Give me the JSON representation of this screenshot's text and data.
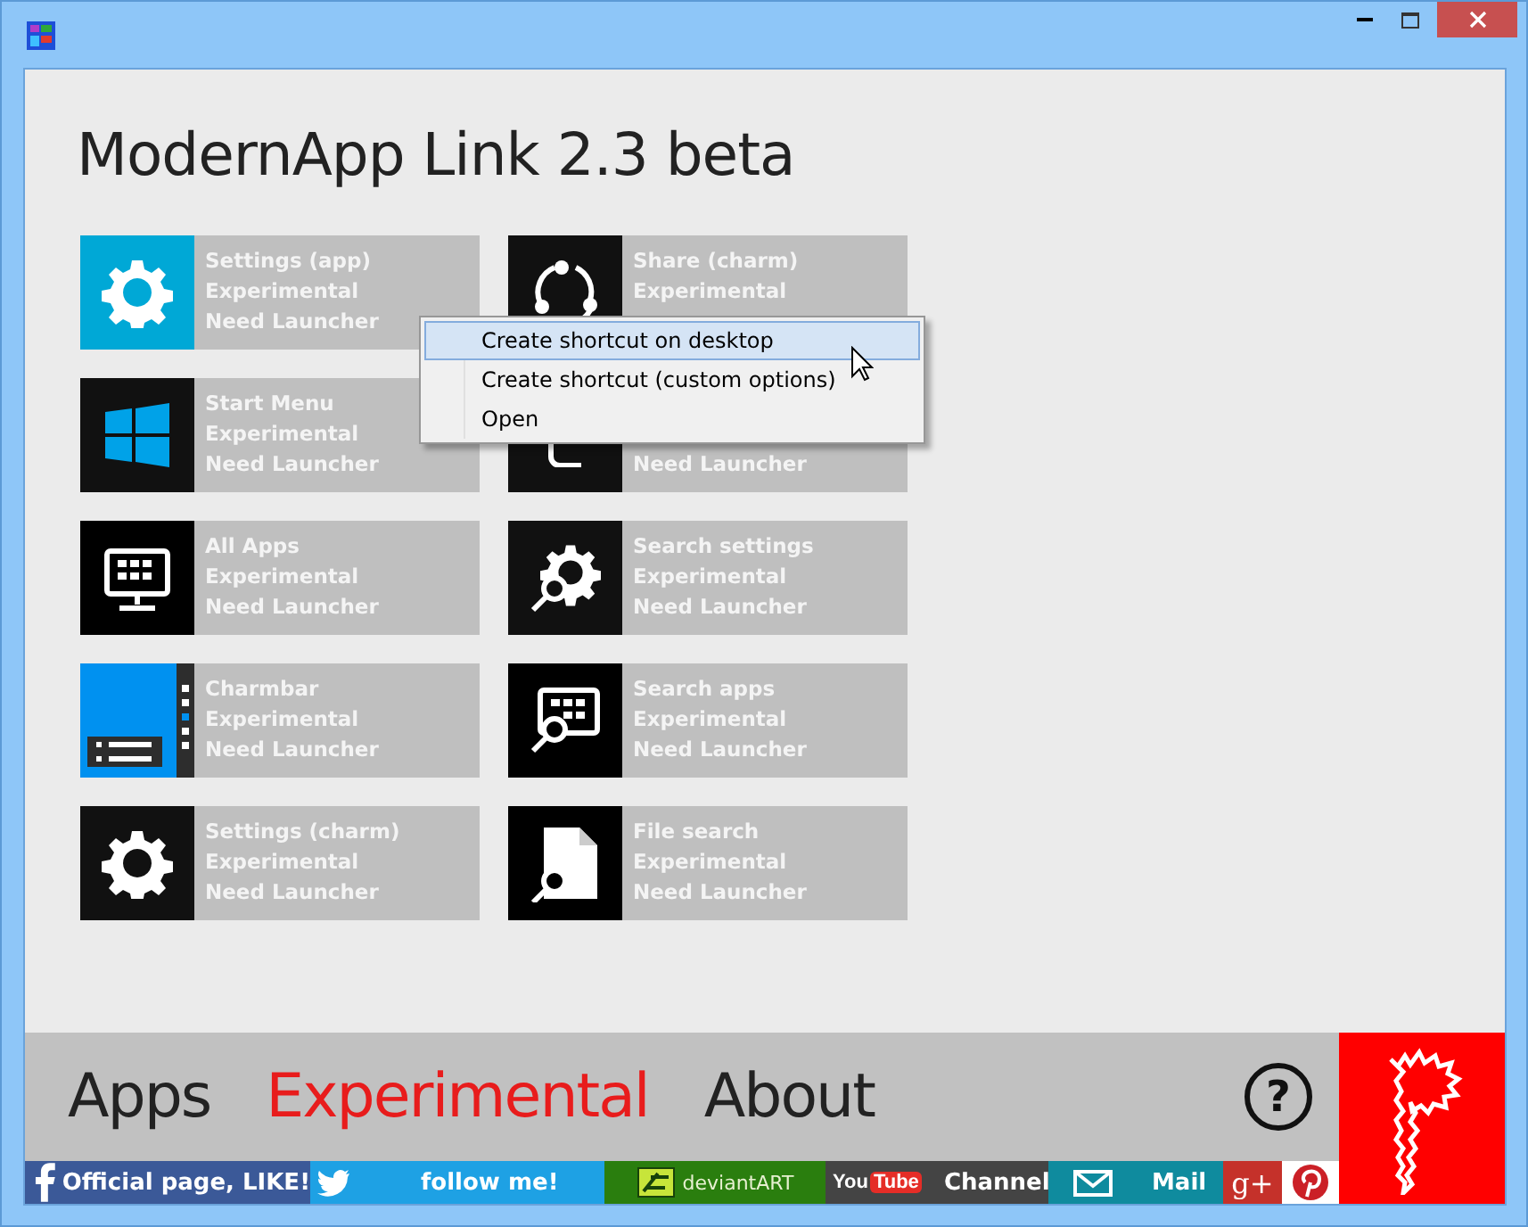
{
  "window": {
    "controls": [
      {
        "kind": "minimize"
      },
      {
        "kind": "maximize"
      },
      {
        "kind": "close"
      }
    ]
  },
  "title": "ModernApp Link 2.3 beta",
  "tiles": [
    {
      "title": "Settings (app)",
      "status": "Experimental",
      "requirement": "Need Launcher"
    },
    {
      "title": "Share (charm)",
      "status": "Experimental"
    },
    {
      "title": "Start Menu",
      "status": "Experimental",
      "requirement": "Need Launcher"
    },
    {
      "requirement": "Need Launcher"
    },
    {
      "title": "All Apps",
      "status": "Experimental",
      "requirement": "Need Launcher"
    },
    {
      "title": "Search settings",
      "status": "Experimental",
      "requirement": "Need Launcher"
    },
    {
      "title": "Charmbar",
      "status": "Experimental",
      "requirement": "Need Launcher"
    },
    {
      "title": "Search apps",
      "status": "Experimental",
      "requirement": "Need Launcher"
    },
    {
      "title": "Settings (charm)",
      "status": "Experimental",
      "requirement": "Need Launcher"
    },
    {
      "title": "File search",
      "status": "Experimental",
      "requirement": "Need Launcher"
    }
  ],
  "context_menu": {
    "items": [
      {
        "label": "Create shortcut on desktop",
        "selected": true
      },
      {
        "label": "Create shortcut (custom options)",
        "selected": false
      },
      {
        "label": "Open",
        "selected": false
      }
    ]
  },
  "nav_tabs": [
    {
      "label": "Apps",
      "selected": false
    },
    {
      "label": "Experimental",
      "selected": true
    },
    {
      "label": "About",
      "selected": false
    }
  ],
  "help_button": "?",
  "social_links": [
    {
      "kind": "facebook",
      "label": "Official page, LIKE!",
      "color": "#3b5998"
    },
    {
      "kind": "twitter",
      "label": "follow me!",
      "color": "#1ea1e4"
    },
    {
      "kind": "deviantart",
      "label": "deviantART",
      "color": "#2a7e0e"
    },
    {
      "kind": "youtube",
      "logo": [
        "You",
        "Tube"
      ],
      "label": "Channel",
      "color": "#444444"
    },
    {
      "kind": "mail",
      "label": "Mail",
      "color": "#0f8b9e"
    },
    {
      "kind": "googleplus",
      "label": "g+",
      "color": "#c5312a"
    },
    {
      "kind": "pinterest",
      "color": "#ffffff"
    }
  ]
}
